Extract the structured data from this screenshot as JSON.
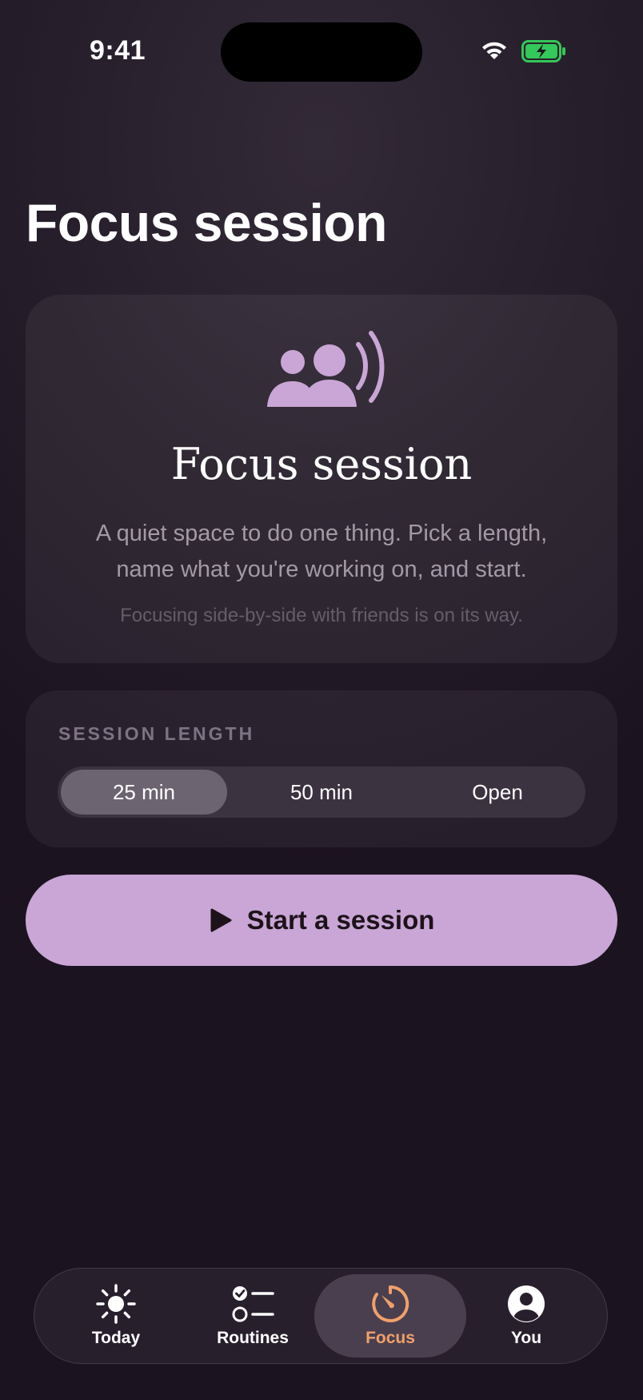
{
  "status_bar": {
    "time": "9:41"
  },
  "page": {
    "title": "Focus session"
  },
  "hero": {
    "icon": "people-speaking-icon",
    "title": "Focus session",
    "description": "A quiet space to do one thing. Pick a length, name what you're working on, and start.",
    "note": "Focusing side-by-side with friends is on its way."
  },
  "session_length": {
    "label": "SESSION LENGTH",
    "options": [
      "25 min",
      "50 min",
      "Open"
    ],
    "selected": "25 min"
  },
  "start_button": {
    "label": "Start a session",
    "icon": "play-icon"
  },
  "tabbar": {
    "items": [
      {
        "label": "Today",
        "icon": "sun-icon"
      },
      {
        "label": "Routines",
        "icon": "checklist-icon"
      },
      {
        "label": "Focus",
        "icon": "timer-icon"
      },
      {
        "label": "You",
        "icon": "person-circle-icon"
      }
    ],
    "active": "Focus"
  },
  "colors": {
    "accent": "#c9a6d6",
    "tab_active": "#f0a06a",
    "battery": "#34c759"
  }
}
